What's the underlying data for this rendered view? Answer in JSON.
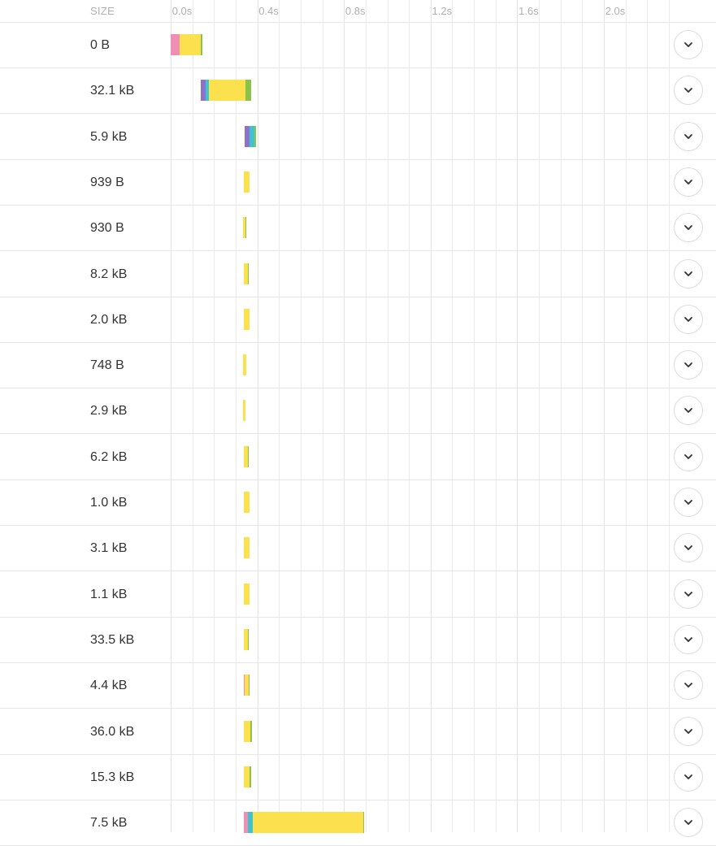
{
  "header": {
    "size_label": "SIZE",
    "ticks": [
      "0.0s",
      "0.4s",
      "0.8s",
      "1.2s",
      "1.6s",
      "2.0s"
    ]
  },
  "colors": {
    "pink": "#f08fb4",
    "purple": "#8e72c9",
    "cyan": "#3ec3d0",
    "yellow": "#fbe14e",
    "green": "#8bc34a"
  },
  "rows": [
    {
      "size": "0 B",
      "segments": [
        [
          "pink",
          0.0,
          0.04
        ],
        [
          "yellow",
          0.04,
          0.14
        ],
        [
          "green",
          0.14,
          0.146
        ]
      ]
    },
    {
      "size": "32.1 kB",
      "segments": [
        [
          "purple",
          0.14,
          0.16
        ],
        [
          "cyan",
          0.16,
          0.175
        ],
        [
          "yellow",
          0.175,
          0.345
        ],
        [
          "green",
          0.345,
          0.37
        ]
      ]
    },
    {
      "size": "5.9 kB",
      "segments": [
        [
          "purple",
          0.34,
          0.363
        ],
        [
          "cyan",
          0.363,
          0.387
        ],
        [
          "green",
          0.387,
          0.394
        ]
      ]
    },
    {
      "size": "939 B",
      "segments": [
        [
          "yellow",
          0.336,
          0.364
        ]
      ]
    },
    {
      "size": "930 B",
      "segments": [
        [
          "yellow",
          0.335,
          0.346
        ],
        [
          "green",
          0.346,
          0.35
        ]
      ]
    },
    {
      "size": "8.2 kB",
      "segments": [
        [
          "yellow",
          0.336,
          0.356
        ],
        [
          "green",
          0.356,
          0.362
        ]
      ]
    },
    {
      "size": "2.0 kB",
      "segments": [
        [
          "yellow",
          0.336,
          0.364
        ]
      ]
    },
    {
      "size": "748 B",
      "segments": [
        [
          "yellow",
          0.335,
          0.348
        ]
      ]
    },
    {
      "size": "2.9 kB",
      "segments": [
        [
          "yellow",
          0.335,
          0.345
        ]
      ]
    },
    {
      "size": "6.2 kB",
      "segments": [
        [
          "yellow",
          0.336,
          0.357
        ],
        [
          "green",
          0.357,
          0.362
        ]
      ]
    },
    {
      "size": "1.0 kB",
      "segments": [
        [
          "yellow",
          0.336,
          0.364
        ]
      ]
    },
    {
      "size": "3.1 kB",
      "segments": [
        [
          "yellow",
          0.336,
          0.364
        ]
      ]
    },
    {
      "size": "1.1 kB",
      "segments": [
        [
          "yellow",
          0.336,
          0.364
        ]
      ]
    },
    {
      "size": "33.5 kB",
      "segments": [
        [
          "yellow",
          0.336,
          0.357
        ],
        [
          "green",
          0.357,
          0.362
        ]
      ]
    },
    {
      "size": "4.4 kB",
      "segments": [
        [
          "pink",
          0.336,
          0.34
        ],
        [
          "yellow",
          0.34,
          0.36
        ],
        [
          "green",
          0.36,
          0.364
        ]
      ]
    },
    {
      "size": "36.0 kB",
      "segments": [
        [
          "yellow",
          0.338,
          0.368
        ],
        [
          "green",
          0.368,
          0.374
        ]
      ]
    },
    {
      "size": "15.3 kB",
      "segments": [
        [
          "yellow",
          0.338,
          0.364
        ],
        [
          "green",
          0.364,
          0.37
        ]
      ]
    },
    {
      "size": "7.5 kB",
      "segments": [
        [
          "pink",
          0.336,
          0.358
        ],
        [
          "cyan",
          0.358,
          0.38
        ],
        [
          "yellow",
          0.38,
          0.89
        ],
        [
          "green",
          0.89,
          0.895
        ]
      ]
    }
  ]
}
